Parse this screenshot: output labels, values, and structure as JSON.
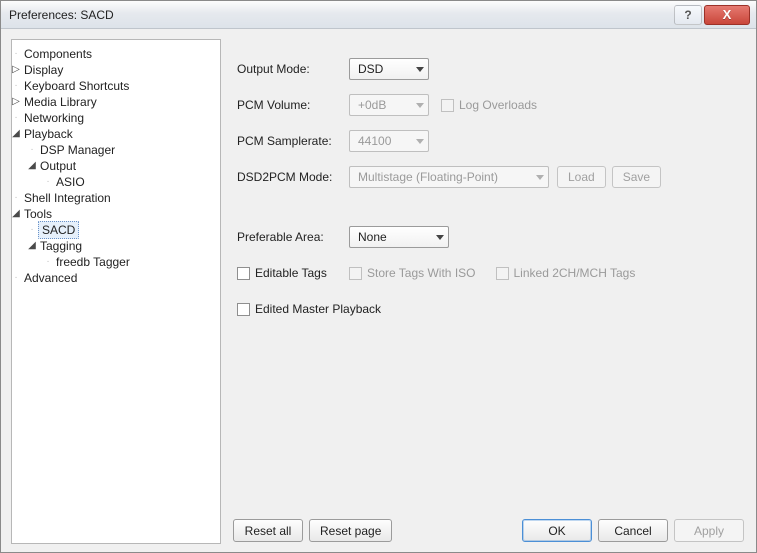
{
  "window": {
    "title": "Preferences: SACD"
  },
  "titlebar": {
    "help_glyph": "?",
    "close_glyph": "X"
  },
  "tree": {
    "components": "Components",
    "display": "Display",
    "keyboard": "Keyboard Shortcuts",
    "media_library": "Media Library",
    "networking": "Networking",
    "playback": "Playback",
    "dsp_manager": "DSP Manager",
    "output": "Output",
    "asio": "ASIO",
    "shell": "Shell Integration",
    "tools": "Tools",
    "sacd": "SACD",
    "tagging": "Tagging",
    "freedb": "freedb Tagger",
    "advanced": "Advanced"
  },
  "form": {
    "output_mode": {
      "label": "Output Mode:",
      "value": "DSD"
    },
    "pcm_volume": {
      "label": "PCM Volume:",
      "value": "+0dB",
      "log_overloads": "Log Overloads"
    },
    "pcm_samplerate": {
      "label": "PCM Samplerate:",
      "value": "44100"
    },
    "dsd2pcm": {
      "label": "DSD2PCM Mode:",
      "value": "Multistage (Floating-Point)",
      "load": "Load",
      "save": "Save"
    },
    "preferable_area": {
      "label": "Preferable Area:",
      "value": "None"
    },
    "editable_tags": "Editable Tags",
    "store_tags_iso": "Store Tags With ISO",
    "linked_channels": "Linked 2CH/MCH Tags",
    "edited_master_playback": "Edited Master Playback"
  },
  "footer": {
    "reset_all": "Reset all",
    "reset_page": "Reset page",
    "ok": "OK",
    "cancel": "Cancel",
    "apply": "Apply"
  }
}
